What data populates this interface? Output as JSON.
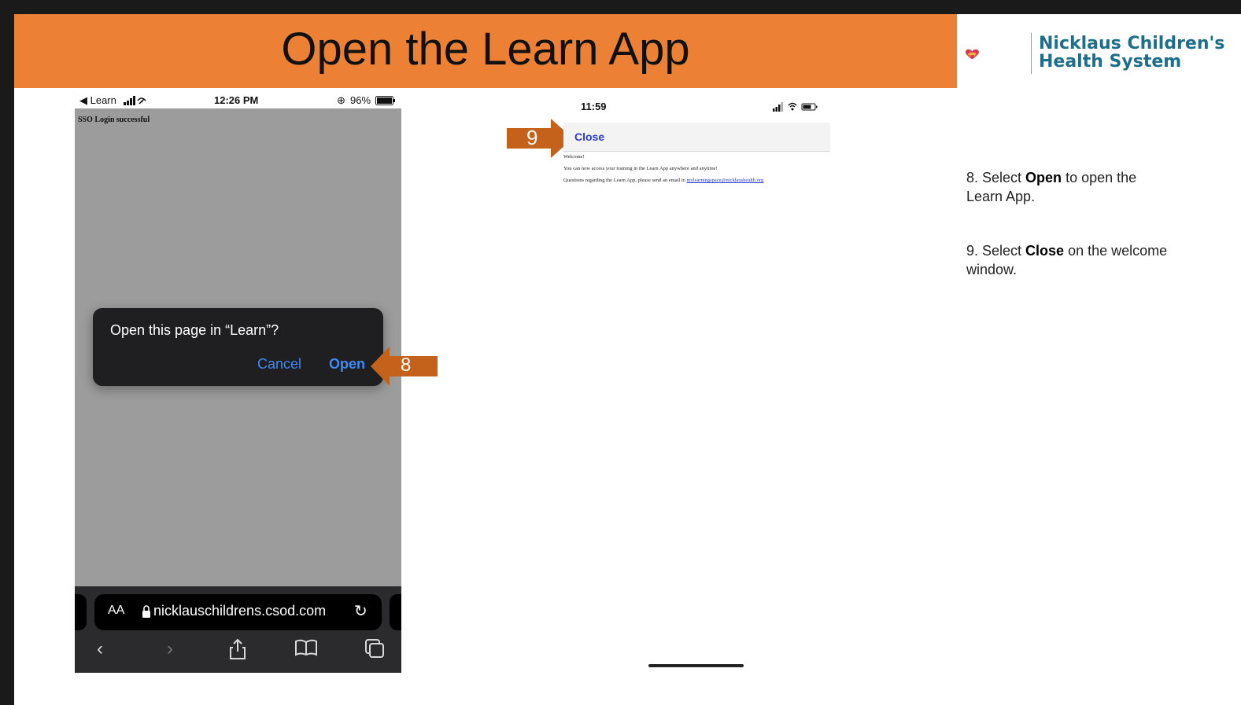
{
  "slide": {
    "title": "Open the Learn App",
    "logo": {
      "line1": "Nicklaus Children's",
      "line2": "Health System",
      "icon": "heart-bear-icon"
    }
  },
  "phone1": {
    "status": {
      "back_label": "◀ Learn",
      "time": "12:26 PM",
      "battery": "96%"
    },
    "page_text": "SSO Login successful",
    "dialog": {
      "message": "Open this page in “Learn”?",
      "cancel_label": "Cancel",
      "open_label": "Open"
    },
    "address_bar": {
      "text_size_label": "AA",
      "url": "nicklauschildrens.csod.com"
    },
    "toolbar_icons": [
      "back-icon",
      "forward-icon",
      "share-icon",
      "bookmarks-icon",
      "tabs-icon"
    ]
  },
  "phone2": {
    "status": {
      "time": "11:59"
    },
    "close_label": "Close",
    "welcome": "Welcome!",
    "line1": "You can now access your training in the Learn App anywhere and anytime!",
    "line2_prefix": "Questions regarding the Learn App, please send an email to ",
    "email": "mylearningspace@nicklaushealth.org"
  },
  "callouts": {
    "step8_number": "8",
    "step9_number": "9",
    "accent_color": "#c4611b"
  },
  "instructions": {
    "step8": {
      "prefix": "8. Select ",
      "bold": "Open",
      "suffix": " to open the Learn App."
    },
    "step9": {
      "prefix": "9. Select ",
      "bold": "Close",
      "suffix": " on the welcome window."
    }
  },
  "colors": {
    "title_bar": "#ec8035",
    "logo_text": "#1c6e8a",
    "ios_blue": "#3d8bf6"
  }
}
